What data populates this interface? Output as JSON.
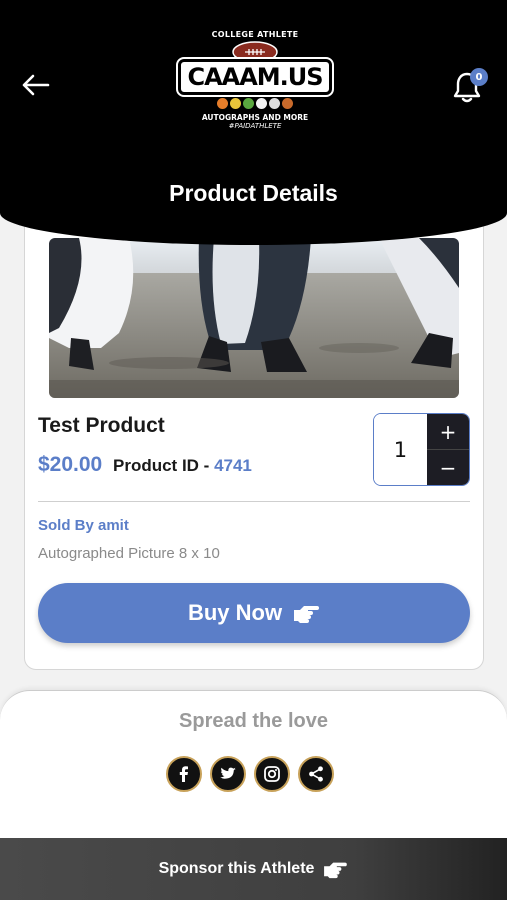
{
  "header": {
    "title": "Product Details",
    "back_icon": "arrow-left-icon",
    "notification_icon": "bell-icon",
    "notification_count": "0",
    "logo": {
      "top_text": "COLLEGE ATHLETE",
      "brand": "CAAAM.US",
      "subtitle": "AUTOGRAPHS AND MORE",
      "tagline": "#PAIDATHLETE"
    }
  },
  "product": {
    "name": "Test Product",
    "price": "$20.00",
    "id_label": "Product ID - ",
    "id_value": "4741",
    "quantity": "1",
    "qty_plus": "+",
    "qty_minus": "−",
    "sold_by": "Sold By amit",
    "description": "Autographed Picture 8 x 10",
    "buy_label": "Buy Now"
  },
  "share": {
    "title": "Spread the love",
    "icons": [
      "facebook-icon",
      "twitter-icon",
      "instagram-icon",
      "share-icon"
    ]
  },
  "footer": {
    "sponsor_label": "Sponsor this Athlete"
  },
  "colors": {
    "accent": "#5b7ec8",
    "header_bg": "#000000",
    "dark_button": "#1d1d24"
  }
}
